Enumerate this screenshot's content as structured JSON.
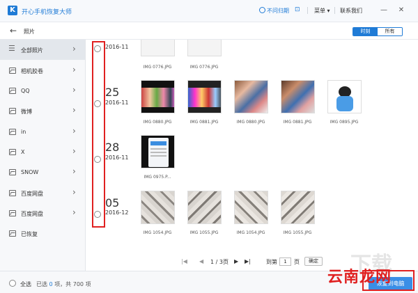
{
  "app": {
    "title": "开心手机恢复大师",
    "logo_letter": "K",
    "user_link": "不问归期",
    "menu_label": "菜单",
    "contact_label": "联系我们"
  },
  "subheader": {
    "title": "照片",
    "view_time": "时刻",
    "view_all": "所有"
  },
  "sidebar": {
    "items": [
      {
        "label": "全部照片"
      },
      {
        "label": "相机胶卷"
      },
      {
        "label": "QQ"
      },
      {
        "label": "微博"
      },
      {
        "label": "in"
      },
      {
        "label": "X"
      },
      {
        "label": "SNOW"
      },
      {
        "label": "百度网盘"
      },
      {
        "label": "百度网盘"
      },
      {
        "label": "已恢复"
      }
    ]
  },
  "groups": [
    {
      "day": "",
      "month": "2016-11",
      "photos": [
        "IMG 0776.JPG",
        "IMG 0776.JPG"
      ]
    },
    {
      "day": "25",
      "month": "2016-11",
      "photos": [
        "IMG 0880.JPG",
        "IMG 0881.JPG",
        "IMG 0880.JPG",
        "IMG 0881.JPG",
        "IMG 0895.JPG"
      ]
    },
    {
      "day": "28",
      "month": "2016-11",
      "photos": [
        "IMG 0975.P..."
      ]
    },
    {
      "day": "05",
      "month": "2016-12",
      "photos": [
        "IMG 1054.JPG",
        "IMG 1055.JPG",
        "IMG 1054.JPG",
        "IMG 1055.JPG"
      ]
    }
  ],
  "pager": {
    "page_info": "1 / 3页",
    "goto_prefix": "到第",
    "goto_value": "1",
    "goto_suffix": "页",
    "confirm": "确定"
  },
  "footer": {
    "select_all": "全选",
    "selected_prefix": "已选",
    "selected_count": "0",
    "selected_mid": "项，共",
    "total_count": "700",
    "selected_suffix": "项",
    "export_label": "恢复到电脑"
  },
  "watermark": {
    "big": "云南龙网",
    "faint": "下载"
  },
  "colors": {
    "accent": "#1f7bd6",
    "highlight": "#e02020"
  }
}
